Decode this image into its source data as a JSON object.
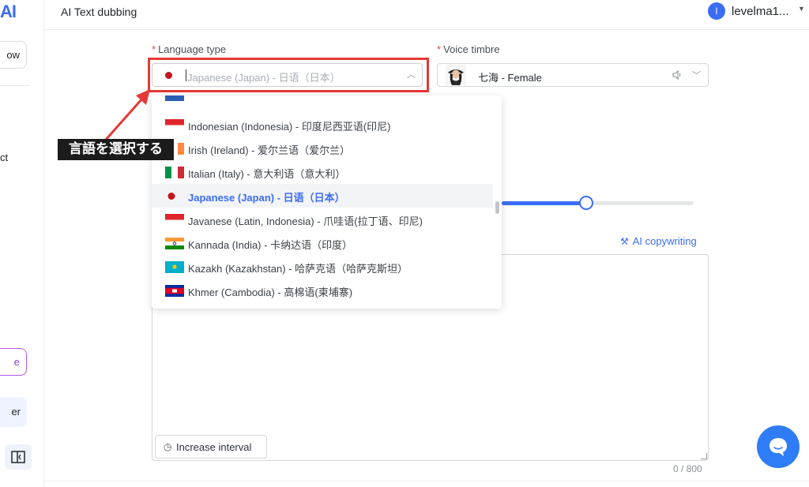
{
  "app": {
    "logo_text": "AI",
    "page_title": "AI Text dubbing"
  },
  "user": {
    "avatar_letter": "l",
    "name": "levelma1..."
  },
  "sidebar": {
    "top_button_fragment": "ow",
    "text_fragment": "ct",
    "purple_button_fragment": "e",
    "blue_button_fragment": "er",
    "icon_button": "sidebar-toggle-icon"
  },
  "form": {
    "language_label": "Language type",
    "language_value": "Japanese (Japan) - 日语（日本）",
    "voice_label": "Voice timbre",
    "voice_value": "七海 - Female",
    "ai_copywriting": "AI copywriting",
    "increase_interval": "Increase interval",
    "char_count": "0 / 800",
    "slider_value": 0.44
  },
  "dropdown": {
    "items": [
      {
        "label": "",
        "flag": "partial"
      },
      {
        "label": "Indonesian (Indonesia) - 印度尼西亚语(印尼)",
        "flag": "indonesia"
      },
      {
        "label": "Irish (Ireland) - 爱尔兰语（爱尔兰）",
        "flag": "ireland"
      },
      {
        "label": "Italian (Italy) - 意大利语（意大利）",
        "flag": "italy"
      },
      {
        "label": "Japanese (Japan) - 日语（日本）",
        "flag": "japan",
        "selected": true
      },
      {
        "label": "Javanese (Latin, Indonesia) - 爪哇语(拉丁语、印尼)",
        "flag": "indonesia"
      },
      {
        "label": "Kannada (India) - 卡纳达语（印度）",
        "flag": "india"
      },
      {
        "label": "Kazakh (Kazakhstan) - 哈萨克语（哈萨克斯坦）",
        "flag": "kazakhstan"
      },
      {
        "label": "Khmer (Cambodia) - 高棉语(柬埔寨)",
        "flag": "cambodia"
      }
    ]
  },
  "annotation": {
    "callout_text": "言語を選択する",
    "color": "#e53935"
  },
  "colors": {
    "accent": "#3b6cf6",
    "highlight": "#e53935",
    "chat": "#2f7df6"
  }
}
